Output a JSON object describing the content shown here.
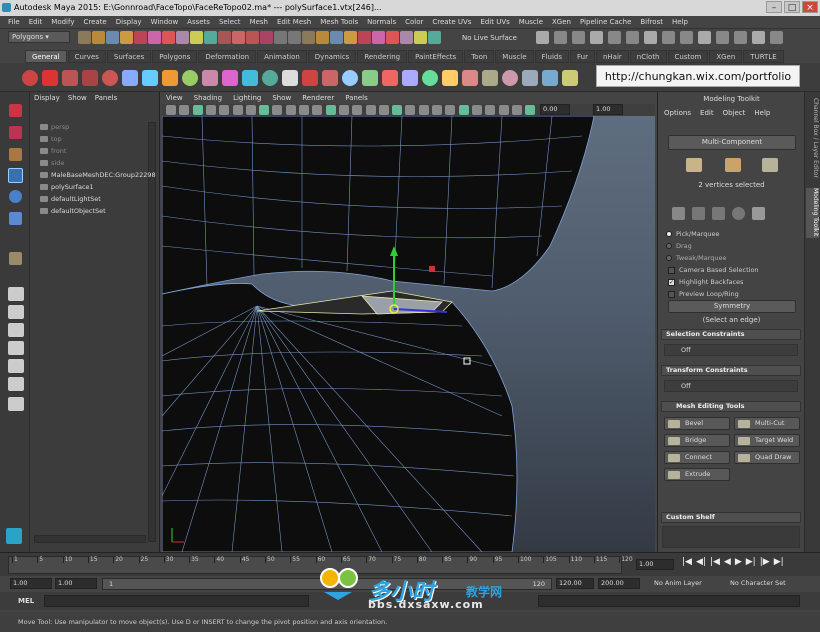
{
  "window": {
    "title": "Autodesk Maya 2015: E:\\Gonnroad\\FaceTopo\\FaceReTopo02.ma*   ---   polySurface1.vtx[246]..."
  },
  "menubar": [
    "File",
    "Edit",
    "Modify",
    "Create",
    "Display",
    "Window",
    "Assets",
    "Select",
    "Mesh",
    "Edit Mesh",
    "Mesh Tools",
    "Normals",
    "Color",
    "Create UVs",
    "Edit UVs",
    "Muscle",
    "XGen",
    "Pipeline Cache",
    "Bifrost",
    "Help"
  ],
  "status_line": {
    "mode": "Polygons",
    "live_surface": "No Live Surface"
  },
  "shelf": {
    "tabs": [
      "General",
      "Curves",
      "Surfaces",
      "Polygons",
      "Deformation",
      "Animation",
      "Dynamics",
      "Rendering",
      "PaintEffects",
      "Toon",
      "Muscle",
      "Fluids",
      "Fur",
      "nHair",
      "nCloth",
      "Custom",
      "XGen",
      "TURTLE"
    ],
    "active_tab": "General"
  },
  "watermark_url": "http://chungkan.wix.com/portfolio",
  "outliner": {
    "menu": [
      "Display",
      "Show",
      "Panels"
    ],
    "items": [
      {
        "label": "persp",
        "dim": true
      },
      {
        "label": "top",
        "dim": true
      },
      {
        "label": "front",
        "dim": true
      },
      {
        "label": "side",
        "dim": true
      },
      {
        "label": "MaleBaseMeshDEC:Group22298",
        "dim": false
      },
      {
        "label": "polySurface1",
        "dim": false
      },
      {
        "label": "defaultLightSet",
        "dim": false
      },
      {
        "label": "defaultObjectSet",
        "dim": false
      }
    ]
  },
  "viewport": {
    "menu": [
      "View",
      "Shading",
      "Lighting",
      "Show",
      "Renderer",
      "Panels"
    ],
    "fields": {
      "a": "0.00",
      "b": "1.00"
    }
  },
  "toolkit": {
    "title": "Modeling Toolkit",
    "menu": [
      "Options",
      "Edit",
      "Object",
      "Help"
    ],
    "multi_component": "Multi-Component",
    "selection_info": "2 vertices selected",
    "pick_options": [
      {
        "label": "Pick/Marquee",
        "on": true
      },
      {
        "label": "Drag",
        "on": false
      },
      {
        "label": "Tweak/Marquee",
        "on": false
      }
    ],
    "checks": [
      {
        "label": "Camera Based Selection",
        "on": false
      },
      {
        "label": "Highlight Backfaces",
        "on": true
      },
      {
        "label": "Preview Loop/Ring",
        "on": false
      }
    ],
    "symmetry_button": "Symmetry",
    "symmetry_hint": "(Select an edge)",
    "sections": {
      "selection_constraints": "Selection Constraints",
      "transform_constraints": "Transform Constraints",
      "mesh_editing_tools": "Mesh Editing Tools",
      "custom_shelf": "Custom Shelf"
    },
    "off_label": "Off",
    "tools": [
      "Bevel",
      "Multi-Cut",
      "Bridge",
      "Target Weld",
      "Connect",
      "Quad Draw",
      "Extrude"
    ]
  },
  "side_tabs": [
    "Channel Box / Layer Editor",
    "Modeling Toolkit"
  ],
  "timeline": {
    "ticks": [
      "1",
      "5",
      "10",
      "15",
      "20",
      "25",
      "30",
      "35",
      "40",
      "45",
      "50",
      "55",
      "60",
      "65",
      "70",
      "75",
      "80",
      "85",
      "90",
      "95",
      "100",
      "105",
      "110",
      "115",
      "120"
    ],
    "current_frame": "1.00"
  },
  "range": {
    "start": "1.00",
    "start2": "1.00",
    "mid": "1",
    "end": "120",
    "end2": "120.00",
    "end3": "200.00",
    "anim_layer": "No Anim Layer",
    "char_set": "No Character Set"
  },
  "mel_label": "MEL",
  "help_line": "Move Tool: Use manipulator to move object(s). Use D or INSERT to change the pivot position and axis orientation.",
  "site_watermark": {
    "cn_title": "多小时",
    "cn_sub": "教学网",
    "url": "bbs.dxsaxw.com"
  },
  "colors": {
    "accent": "#5fb6ff",
    "wire": "#7fa2d6",
    "mesh": "#0d0d0d",
    "highlight": "#e8e8a8"
  }
}
